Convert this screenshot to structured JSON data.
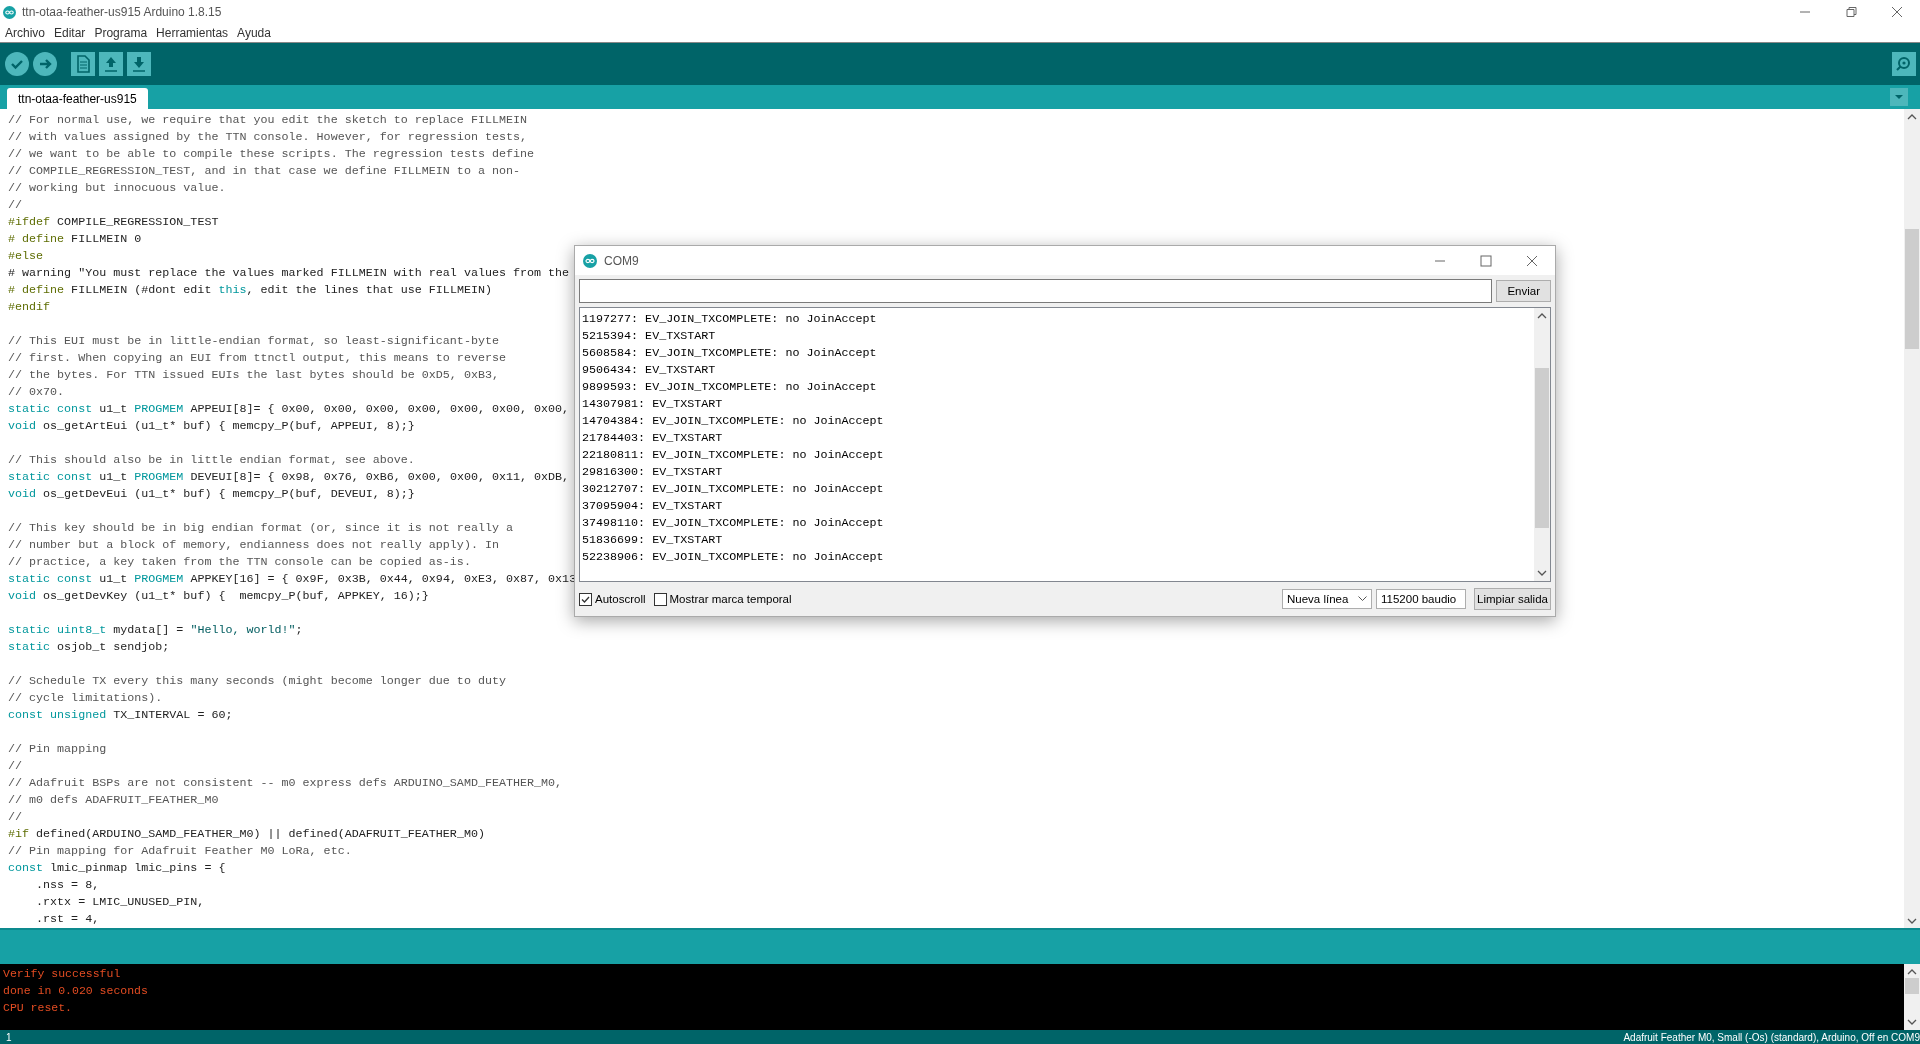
{
  "window": {
    "title": "ttn-otaa-feather-us915 Arduino 1.8.15"
  },
  "menu": [
    "Archivo",
    "Editar",
    "Programa",
    "Herramientas",
    "Ayuda"
  ],
  "tabs": [
    {
      "label": "ttn-otaa-feather-us915",
      "selected": true
    }
  ],
  "editor": {
    "lines": [
      {
        "kind": "code",
        "parts": [
          {
            "kind": "comment",
            "text": "// For normal use, we require that you edit the sketch to replace FILLMEIN"
          }
        ]
      },
      {
        "kind": "code",
        "parts": [
          {
            "kind": "comment",
            "text": "// with values assigned by the TTN console. However, for regression tests,"
          }
        ]
      },
      {
        "kind": "code",
        "parts": [
          {
            "kind": "comment",
            "text": "// we want to be able to compile these scripts. The regression tests define"
          }
        ]
      },
      {
        "kind": "code",
        "parts": [
          {
            "kind": "comment",
            "text": "// COMPILE_REGRESSION_TEST, and in that case we define FILLMEIN to a non-"
          }
        ]
      },
      {
        "kind": "code",
        "parts": [
          {
            "kind": "comment",
            "text": "// working but innocuous value."
          }
        ]
      },
      {
        "kind": "code",
        "parts": [
          {
            "kind": "comment",
            "text": "//"
          }
        ]
      },
      {
        "kind": "code",
        "parts": [
          {
            "kind": "preproc",
            "text": "#ifdef"
          },
          {
            "kind": "plain",
            "text": " COMPILE_REGRESSION_TEST"
          }
        ]
      },
      {
        "kind": "code",
        "parts": [
          {
            "kind": "preproc",
            "text": "# define"
          },
          {
            "kind": "plain",
            "text": " FILLMEIN 0"
          }
        ]
      },
      {
        "kind": "code",
        "parts": [
          {
            "kind": "preproc",
            "text": "#else"
          }
        ]
      },
      {
        "kind": "code",
        "parts": [
          {
            "kind": "plain",
            "text": "# warning \"You must replace the values marked FILLMEIN with real values from the"
          }
        ]
      },
      {
        "kind": "code",
        "parts": [
          {
            "kind": "preproc",
            "text": "# define"
          },
          {
            "kind": "plain",
            "text": " FILLMEIN (#dont edit "
          },
          {
            "kind": "keyword",
            "text": "this"
          },
          {
            "kind": "plain",
            "text": ", edit the lines that use FILLMEIN)"
          }
        ]
      },
      {
        "kind": "code",
        "parts": [
          {
            "kind": "preproc",
            "text": "#endif"
          }
        ]
      },
      {
        "kind": "blank"
      },
      {
        "kind": "code",
        "parts": [
          {
            "kind": "comment",
            "text": "// This EUI must be in little-endian format, so least-significant-byte"
          }
        ]
      },
      {
        "kind": "code",
        "parts": [
          {
            "kind": "comment",
            "text": "// first. When copying an EUI from ttnctl output, this means to reverse"
          }
        ]
      },
      {
        "kind": "code",
        "parts": [
          {
            "kind": "comment",
            "text": "// the bytes. For TTN issued EUIs the last bytes should be 0xD5, 0xB3,"
          }
        ]
      },
      {
        "kind": "code",
        "parts": [
          {
            "kind": "comment",
            "text": "// 0x70."
          }
        ]
      },
      {
        "kind": "code",
        "parts": [
          {
            "kind": "keyword",
            "text": "static const"
          },
          {
            "kind": "plain",
            "text": " u1_t "
          },
          {
            "kind": "keyword",
            "text": "PROGMEM"
          },
          {
            "kind": "plain",
            "text": " APPEUI[8]= { 0x00, 0x00, 0x00, 0x00, 0x00, 0x00, 0x00,"
          }
        ]
      },
      {
        "kind": "code",
        "parts": [
          {
            "kind": "keyword",
            "text": "void"
          },
          {
            "kind": "plain",
            "text": " os_getArtEui (u1_t* buf) { memcpy_P(buf, APPEUI, 8);}"
          }
        ]
      },
      {
        "kind": "blank"
      },
      {
        "kind": "code",
        "parts": [
          {
            "kind": "comment",
            "text": "// This should also be in little endian format, see above."
          }
        ]
      },
      {
        "kind": "code",
        "parts": [
          {
            "kind": "keyword",
            "text": "static const"
          },
          {
            "kind": "plain",
            "text": " u1_t "
          },
          {
            "kind": "keyword",
            "text": "PROGMEM"
          },
          {
            "kind": "plain",
            "text": " DEVEUI[8]= { 0x98, 0x76, 0xB6, 0x00, 0x00, 0x11, 0xDB,"
          }
        ]
      },
      {
        "kind": "code",
        "parts": [
          {
            "kind": "keyword",
            "text": "void"
          },
          {
            "kind": "plain",
            "text": " os_getDevEui (u1_t* buf) { memcpy_P(buf, DEVEUI, 8);}"
          }
        ]
      },
      {
        "kind": "blank"
      },
      {
        "kind": "code",
        "parts": [
          {
            "kind": "comment",
            "text": "// This key should be in big endian format (or, since it is not really a"
          }
        ]
      },
      {
        "kind": "code",
        "parts": [
          {
            "kind": "comment",
            "text": "// number but a block of memory, endianness does not really apply). In"
          }
        ]
      },
      {
        "kind": "code",
        "parts": [
          {
            "kind": "comment",
            "text": "// practice, a key taken from the TTN console can be copied as-is."
          }
        ]
      },
      {
        "kind": "code",
        "parts": [
          {
            "kind": "keyword",
            "text": "static const"
          },
          {
            "kind": "plain",
            "text": " u1_t "
          },
          {
            "kind": "keyword",
            "text": "PROGMEM"
          },
          {
            "kind": "plain",
            "text": " APPKEY[16] = { 0x9F, 0x3B, 0x44, 0x94, 0xE3, 0x87, 0x13"
          }
        ]
      },
      {
        "kind": "code",
        "parts": [
          {
            "kind": "keyword",
            "text": "void"
          },
          {
            "kind": "plain",
            "text": " os_getDevKey (u1_t* buf) {  memcpy_P(buf, APPKEY, 16);}"
          }
        ]
      },
      {
        "kind": "blank"
      },
      {
        "kind": "code",
        "parts": [
          {
            "kind": "keyword",
            "text": "static uint8_t"
          },
          {
            "kind": "plain",
            "text": " mydata[] = "
          },
          {
            "kind": "string",
            "text": "\"Hello, world!\""
          },
          {
            "kind": "plain",
            "text": ";"
          }
        ]
      },
      {
        "kind": "code",
        "parts": [
          {
            "kind": "keyword",
            "text": "static"
          },
          {
            "kind": "plain",
            "text": " osjob_t sendjob;"
          }
        ]
      },
      {
        "kind": "blank"
      },
      {
        "kind": "code",
        "parts": [
          {
            "kind": "comment",
            "text": "// Schedule TX every this many seconds (might become longer due to duty"
          }
        ]
      },
      {
        "kind": "code",
        "parts": [
          {
            "kind": "comment",
            "text": "// cycle limitations)."
          }
        ]
      },
      {
        "kind": "code",
        "parts": [
          {
            "kind": "keyword",
            "text": "const unsigned"
          },
          {
            "kind": "plain",
            "text": " TX_INTERVAL = 60;"
          }
        ]
      },
      {
        "kind": "blank"
      },
      {
        "kind": "code",
        "parts": [
          {
            "kind": "comment",
            "text": "// Pin mapping"
          }
        ]
      },
      {
        "kind": "code",
        "parts": [
          {
            "kind": "comment",
            "text": "//"
          }
        ]
      },
      {
        "kind": "code",
        "parts": [
          {
            "kind": "comment",
            "text": "// Adafruit BSPs are not consistent -- m0 express defs ARDUINO_SAMD_FEATHER_M0,"
          }
        ]
      },
      {
        "kind": "code",
        "parts": [
          {
            "kind": "comment",
            "text": "// m0 defs ADAFRUIT_FEATHER_M0"
          }
        ]
      },
      {
        "kind": "code",
        "parts": [
          {
            "kind": "comment",
            "text": "//"
          }
        ]
      },
      {
        "kind": "code",
        "parts": [
          {
            "kind": "preproc",
            "text": "#if"
          },
          {
            "kind": "plain",
            "text": " defined(ARDUINO_SAMD_FEATHER_M0) || defined(ADAFRUIT_FEATHER_M0)"
          }
        ]
      },
      {
        "kind": "code",
        "parts": [
          {
            "kind": "comment",
            "text": "// Pin mapping for Adafruit Feather M0 LoRa, etc."
          }
        ]
      },
      {
        "kind": "code",
        "parts": [
          {
            "kind": "keyword",
            "text": "const"
          },
          {
            "kind": "plain",
            "text": " lmic_pinmap lmic_pins = {"
          }
        ]
      },
      {
        "kind": "code",
        "parts": [
          {
            "kind": "plain",
            "text": "    .nss = 8,"
          }
        ]
      },
      {
        "kind": "code",
        "parts": [
          {
            "kind": "plain",
            "text": "    .rxtx = LMIC_UNUSED_PIN,"
          }
        ]
      },
      {
        "kind": "code",
        "parts": [
          {
            "kind": "plain",
            "text": "    .rst = 4,"
          }
        ]
      }
    ]
  },
  "serial_monitor": {
    "title": "COM9",
    "send_button": "Enviar",
    "lines": [
      "1197277: EV_JOIN_TXCOMPLETE: no JoinAccept",
      "5215394: EV_TXSTART",
      "5608584: EV_JOIN_TXCOMPLETE: no JoinAccept",
      "9506434: EV_TXSTART",
      "9899593: EV_JOIN_TXCOMPLETE: no JoinAccept",
      "14307981: EV_TXSTART",
      "14704384: EV_JOIN_TXCOMPLETE: no JoinAccept",
      "21784403: EV_TXSTART",
      "22180811: EV_JOIN_TXCOMPLETE: no JoinAccept",
      "29816300: EV_TXSTART",
      "30212707: EV_JOIN_TXCOMPLETE: no JoinAccept",
      "37095904: EV_TXSTART",
      "37498110: EV_JOIN_TXCOMPLETE: no JoinAccept",
      "51836699: EV_TXSTART",
      "52238906: EV_JOIN_TXCOMPLETE: no JoinAccept"
    ],
    "autoscroll": {
      "label": "Autoscroll",
      "checked": true
    },
    "timestamp": {
      "label": "Mostrar marca temporal",
      "checked": false
    },
    "line_ending": "Nueva línea",
    "baud_rate": "115200 baudio",
    "clear_button": "Limpiar salida"
  },
  "console": {
    "lines": [
      "Verify successful",
      "done in 0.020 seconds",
      "CPU reset."
    ]
  },
  "status_bar": {
    "line": "1",
    "board": "Adafruit Feather M0, Small (-Os) (standard), Arduino, Off en COM9"
  }
}
